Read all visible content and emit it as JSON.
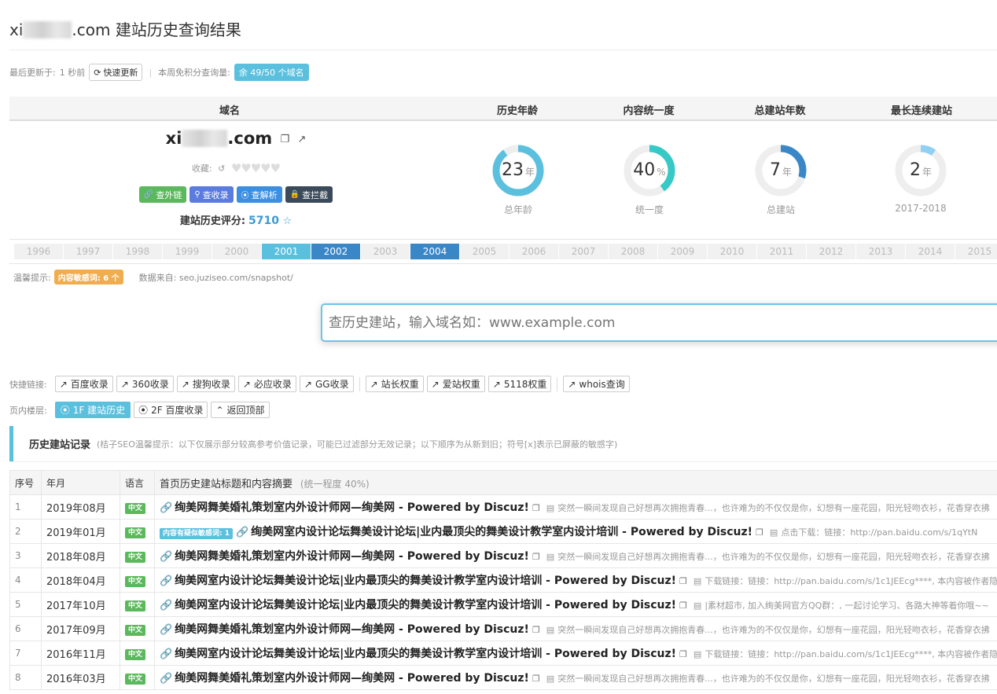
{
  "page": {
    "title_prefix": "xi",
    "title_suffix": ".com 建站历史查询结果"
  },
  "update_bar": {
    "last_update_label": "最后更新于:",
    "last_update_value": "1 秒前",
    "refresh_button": "快速更新",
    "quota_label": "本周免积分查询量:",
    "quota_badge": "余 49/50 个域名"
  },
  "summary_headers": {
    "domain": "域名",
    "history_age": "历史年龄",
    "consistency": "内容统一度",
    "total_years": "总建站年数",
    "longest_run": "最长连续建站"
  },
  "domain_card": {
    "name_prefix": "xi",
    "name_suffix": ".com",
    "favorite_label": "收藏:",
    "hearts": "♥♥♥♥♥",
    "buttons": [
      {
        "label": "查外链",
        "icon": "link-icon",
        "color": "#5cb85c"
      },
      {
        "label": "查收录",
        "icon": "search-icon",
        "color": "#5b7cde"
      },
      {
        "label": "查解析",
        "icon": "map-pin-icon",
        "color": "#3b8ee0"
      },
      {
        "label": "查拦截",
        "icon": "lock-icon",
        "color": "#3a4a5a"
      }
    ],
    "score_label": "建站历史评分:",
    "score_value": "5710"
  },
  "stats": [
    {
      "value": "23",
      "unit": "年",
      "caption": "总年龄",
      "fraction": 0.9,
      "color": "#5bc0de"
    },
    {
      "value": "40",
      "unit": "%",
      "caption": "统一度",
      "fraction": 0.4,
      "color": "#36c9c6"
    },
    {
      "value": "7",
      "unit": "年",
      "caption": "总建站",
      "fraction": 0.3,
      "color": "#3a87c8"
    },
    {
      "value": "2",
      "unit": "年",
      "caption": "2017-2018",
      "fraction": 0.1,
      "color": "#8fd0f5"
    }
  ],
  "years": [
    {
      "y": "1996",
      "state": "none"
    },
    {
      "y": "1997",
      "state": "none"
    },
    {
      "y": "1998",
      "state": "none"
    },
    {
      "y": "1999",
      "state": "none"
    },
    {
      "y": "2000",
      "state": "none"
    },
    {
      "y": "2001",
      "state": "light"
    },
    {
      "y": "2002",
      "state": "dark"
    },
    {
      "y": "2003",
      "state": "none"
    },
    {
      "y": "2004",
      "state": "dark"
    },
    {
      "y": "2005",
      "state": "none"
    },
    {
      "y": "2006",
      "state": "none"
    },
    {
      "y": "2007",
      "state": "none"
    },
    {
      "y": "2008",
      "state": "none"
    },
    {
      "y": "2009",
      "state": "none"
    },
    {
      "y": "2010",
      "state": "none"
    },
    {
      "y": "2011",
      "state": "none"
    },
    {
      "y": "2012",
      "state": "none"
    },
    {
      "y": "2013",
      "state": "none"
    },
    {
      "y": "2014",
      "state": "none"
    },
    {
      "y": "2015",
      "state": "none"
    }
  ],
  "tips": {
    "label": "温馨提示:",
    "badge": "内容敏感词: 6 个",
    "source_label": "数据来自: seo.juziseo.com/snapshot/"
  },
  "search": {
    "placeholder": "查历史建站，输入域名如：www.example.com"
  },
  "quick_links": {
    "label": "快捷链接:",
    "group1": [
      "百度收录",
      "360收录",
      "搜狗收录",
      "必应收录",
      "GG收录"
    ],
    "group2": [
      "站长权重",
      "爱站权重",
      "5118权重"
    ],
    "group3": [
      "whois查询"
    ]
  },
  "floor": {
    "label": "页内楼层:",
    "items": [
      {
        "label": "1F 建站历史",
        "active": true,
        "icon": "map-pin-icon"
      },
      {
        "label": "2F 百度收录",
        "active": false,
        "icon": "map-pin-icon"
      },
      {
        "label": "返回顶部",
        "active": false,
        "icon": "chevron-up-icon"
      }
    ]
  },
  "section": {
    "heading": "历史建站记录",
    "subtitle": "(桔子SEO温馨提示：以下仅展示部分较高参考价值记录，可能已过滤部分无效记录；以下顺序为从新到旧；符号[x]表示已屏蔽的敏感字)"
  },
  "table": {
    "headers": {
      "idx": "序号",
      "month": "年月",
      "lang": "语言",
      "title": "首页历史建站标题和内容摘要",
      "title_note": "(统一程度 40%)"
    },
    "rows": [
      {
        "idx": "1",
        "month": "2019年08月",
        "lang": "中文",
        "warn": "",
        "title": "绚美网舞美婚礼策划室内外设计师网—绚美网 - Powered by Discuz!",
        "snippet": "突然一瞬间发现自己好想再次拥抱青春...，也许难为的不仅仅是你，幻想有一座花园，阳光轻吻衣衫，花香穿衣拂"
      },
      {
        "idx": "2",
        "month": "2019年01月",
        "lang": "中文",
        "warn": "内容有疑似敏感词: 1",
        "title": "绚美网室内设计论坛舞美设计论坛|业内最顶尖的舞美设计教学室内设计培训 - Powered by Discuz!",
        "snippet": "点击下载：链接：http://pan.baidu.com/s/1qYtN"
      },
      {
        "idx": "3",
        "month": "2018年08月",
        "lang": "中文",
        "warn": "",
        "title": "绚美网舞美婚礼策划室内外设计师网—绚美网 - Powered by Discuz!",
        "snippet": "突然一瞬间发现自己好想再次拥抱青春...，也许难为的不仅仅是你，幻想有一座花园，阳光轻吻衣衫，花香穿衣拂"
      },
      {
        "idx": "4",
        "month": "2018年04月",
        "lang": "中文",
        "warn": "",
        "title": "绚美网室内设计论坛舞美设计论坛|业内最顶尖的舞美设计教学室内设计培训 - Powered by Discuz!",
        "snippet": "下载链接：链接：http://pan.baidu.com/s/1c1JEEcg****, 本内容被作者隐"
      },
      {
        "idx": "5",
        "month": "2017年10月",
        "lang": "中文",
        "warn": "",
        "title": "绚美网室内设计论坛舞美设计论坛|业内最顶尖的舞美设计教学室内设计培训 - Powered by Discuz!",
        "snippet": "|素材超市, 加入绚美网官方QQ群：, 一起讨论学习、各路大神等着你哦~~"
      },
      {
        "idx": "6",
        "month": "2017年09月",
        "lang": "中文",
        "warn": "",
        "title": "绚美网舞美婚礼策划室内外设计师网—绚美网 - Powered by Discuz!",
        "snippet": "突然一瞬间发现自己好想再次拥抱青春...，也许难为的不仅仅是你，幻想有一座花园，阳光轻吻衣衫，花香穿衣拂"
      },
      {
        "idx": "7",
        "month": "2016年11月",
        "lang": "中文",
        "warn": "",
        "title": "绚美网室内设计论坛舞美设计论坛|业内最顶尖的舞美设计教学室内设计培训 - Powered by Discuz!",
        "snippet": "下载链接：链接：http://pan.baidu.com/s/1c1JEEcg****, 本内容被作者隐"
      },
      {
        "idx": "8",
        "month": "2016年03月",
        "lang": "中文",
        "warn": "",
        "title": "绚美网舞美婚礼策划室内外设计师网—绚美网 - Powered by Discuz!",
        "snippet": "突然一瞬间发现自己好想再次拥抱青春...，也许难为的不仅仅是你，幻想有一座花园，阳光轻吻衣衫，花香穿衣拂"
      }
    ]
  },
  "colors": {
    "accent": "#5bc0de",
    "year_light": "#5bc0de",
    "year_dark": "#3a87c8",
    "lang_badge": "#5cb85c",
    "warn_badge": "#f0ad4e"
  }
}
